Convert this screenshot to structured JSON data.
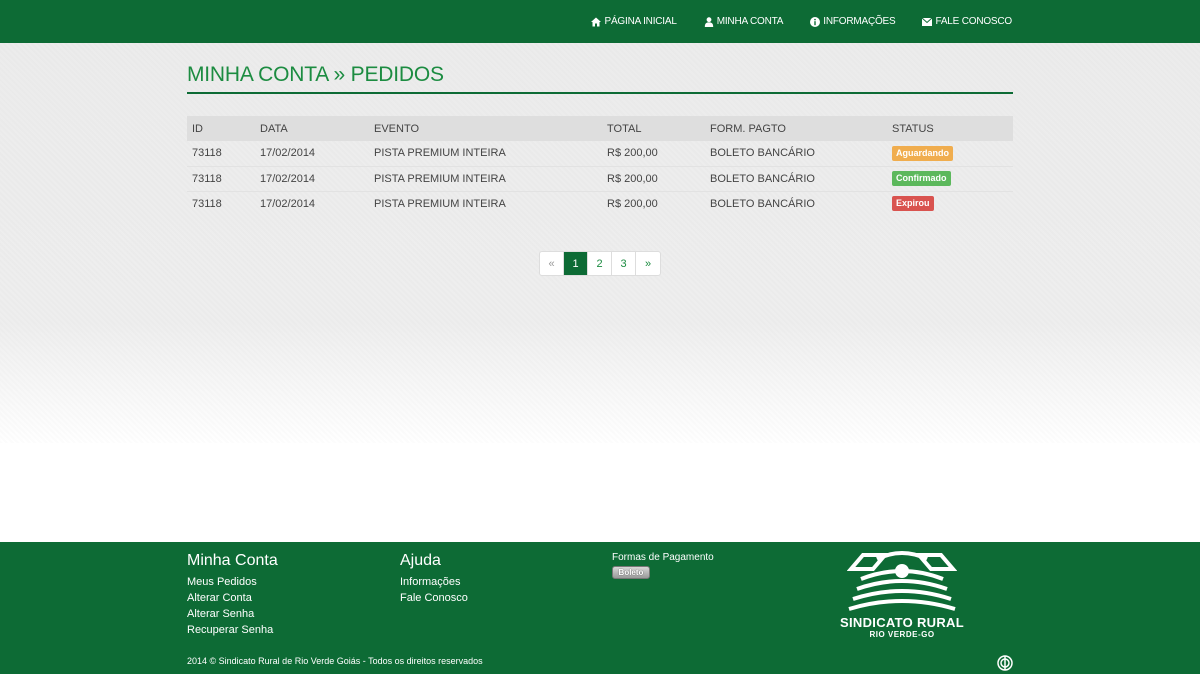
{
  "nav": {
    "home": "PÁGINA INICIAL",
    "account": "MINHA CONTA",
    "info": "INFORMAÇÕES",
    "contact": "FALE CONOSCO"
  },
  "page": {
    "title": "MINHA CONTA » PEDIDOS"
  },
  "table": {
    "headers": [
      "ID",
      "DATA",
      "EVENTO",
      "TOTAL",
      "FORM. PAGTO",
      "STATUS"
    ],
    "rows": [
      {
        "id": "73118",
        "date": "17/02/2014",
        "event": "PISTA PREMIUM INTEIRA",
        "total": "R$ 200,00",
        "payment": "BOLETO BANCÁRIO",
        "status": "Aguardando",
        "status_color": "#f0ad4e"
      },
      {
        "id": "73118",
        "date": "17/02/2014",
        "event": "PISTA PREMIUM INTEIRA",
        "total": "R$ 200,00",
        "payment": "BOLETO BANCÁRIO",
        "status": "Confirmado",
        "status_color": "#5cb85c"
      },
      {
        "id": "73118",
        "date": "17/02/2014",
        "event": "PISTA PREMIUM INTEIRA",
        "total": "R$ 200,00",
        "payment": "BOLETO BANCÁRIO",
        "status": "Expirou",
        "status_color": "#d9534f"
      }
    ]
  },
  "pagination": {
    "prev": "«",
    "pages": [
      "1",
      "2",
      "3"
    ],
    "next": "»",
    "current": "1"
  },
  "footer": {
    "account_title": "Minha Conta",
    "account_links": [
      "Meus Pedidos",
      "Alterar Conta",
      "Alterar Senha",
      "Recuperar Senha"
    ],
    "help_title": "Ajuda",
    "help_links": [
      "Informações",
      "Fale Conosco"
    ],
    "payment_title": "Formas de Pagamento",
    "payment_badge": "Boleto",
    "copyright": "2014 © Sindicato Rural de Rio Verde Goiás - Todos os direitos reservados",
    "logo_name": "SINDICATO RURAL",
    "logo_sub": "RIO VERDE-GO"
  },
  "colors": {
    "brand_green": "#0d6b35",
    "title_green": "#1c8c41"
  }
}
